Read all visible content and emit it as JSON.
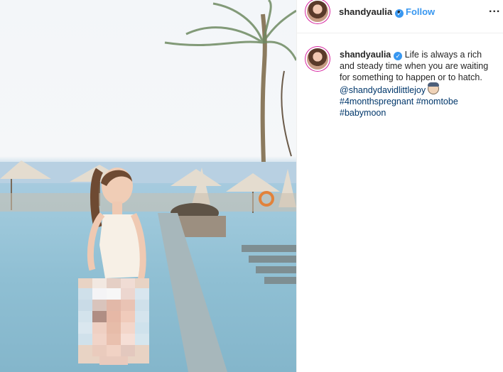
{
  "post": {
    "username": "shandyaulia",
    "follow_label": "Follow",
    "dot_separator": "•",
    "more_label": "...",
    "verified_glyph": "✓",
    "caption": {
      "text": "Life is always a rich and steady time when you are waiting for something to happen or to hatch.",
      "mention": "@shandydavidlittlejoy",
      "hashtags": [
        "#4monthspregnant",
        "#momtobe",
        "#babymoon"
      ]
    }
  },
  "icons": {
    "avatar": "avatar-icon",
    "verified": "verified-badge-icon",
    "more": "more-options-icon",
    "baby": "baby-emoji-icon"
  },
  "colors": {
    "follow_blue": "#3897f0",
    "link_blue": "#00376b",
    "text": "#262626",
    "border": "#efefef"
  }
}
